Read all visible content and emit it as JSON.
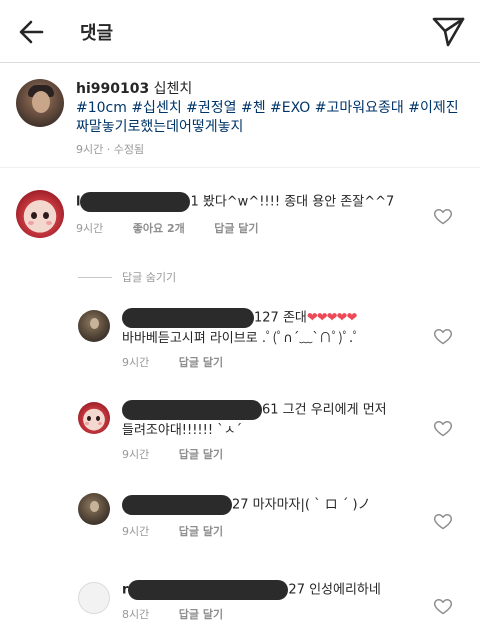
{
  "header": {
    "title": "댓글"
  },
  "caption": {
    "username": "hi990103",
    "text": "십첸치",
    "hashtags": "#10cm #십센치 #권정열 #첸 #EXO #고마워요종대 #이제진짜말놓기로했는데어떻게놓지",
    "meta": "9시간 · 수정됨"
  },
  "comments": [
    {
      "username_visible": "l",
      "text": "1 봤다^w^!!!! 종대 용안 존잘^^7",
      "time": "9시간",
      "likes": "좋아요 2개",
      "reply": "답글 달기"
    }
  ],
  "hide_replies": "답글 숨기기",
  "replies": [
    {
      "text_line1_prefix": "127 존대",
      "text_line1_hearts": "❤❤❤❤❤",
      "text_line2": "바바베듣고시펴 라이브로 .ﾟ(ﾟ∩´﹏`∩ﾟ)ﾟ.ﾟ",
      "time": "9시간",
      "reply": "답글 달기"
    },
    {
      "text_line1": "61 그건 우리에게 먼저",
      "text_line2": "들려조야대!!!!!! `ㅅ´",
      "time": "9시간",
      "reply": "답글 달기"
    },
    {
      "text_line1": "27 마자마자|( ˋ ロ ˊ )ノ",
      "time": "9시간",
      "reply": "답글 달기"
    },
    {
      "username_visible": "r",
      "text_line1": "27 인성에리하네",
      "time": "8시간",
      "reply": "답글 달기"
    }
  ],
  "icons": {
    "back": "arrow-left-icon",
    "send": "paper-plane-icon",
    "like": "heart-outline-icon"
  },
  "colors": {
    "hashtag": "#003569",
    "meta": "#999999",
    "heart_emoji": "#ed4956"
  }
}
